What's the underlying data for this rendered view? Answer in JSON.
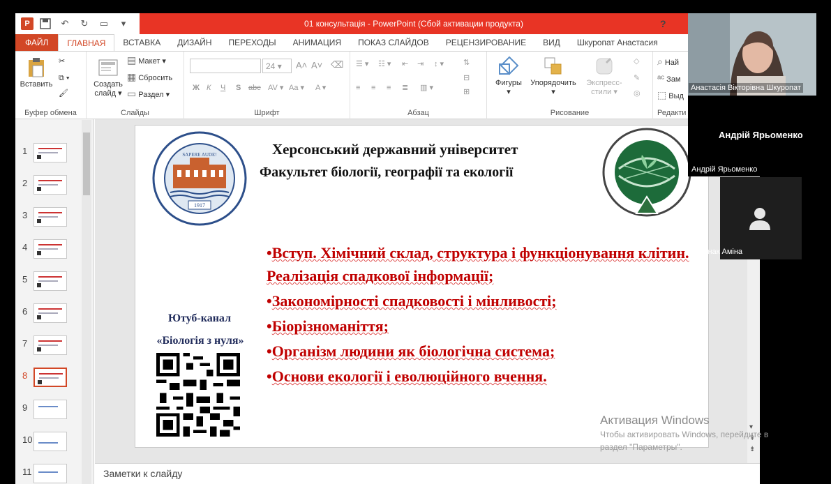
{
  "window": {
    "title": "01 консультація -  PowerPoint (Сбой активации продукта)",
    "help": "?"
  },
  "tabs": [
    {
      "label": "ФАЙЛ"
    },
    {
      "label": "ГЛАВНАЯ"
    },
    {
      "label": "ВСТАВКА"
    },
    {
      "label": "ДИЗАЙН"
    },
    {
      "label": "ПЕРЕХОДЫ"
    },
    {
      "label": "АНИМАЦИЯ"
    },
    {
      "label": "ПОКАЗ СЛАЙДОВ"
    },
    {
      "label": "РЕЦЕНЗИРОВАНИЕ"
    },
    {
      "label": "ВИД"
    },
    {
      "label": "Шкуропат Анастасия"
    }
  ],
  "ribbon": {
    "clipboard": {
      "label": "Буфер обмена",
      "paste": "Вставить"
    },
    "slides": {
      "label": "Слайды",
      "create": "Создать",
      "create2": "слайд",
      "layout": "Макет",
      "reset": "Сбросить",
      "section": "Раздел"
    },
    "font": {
      "label": "Шрифт",
      "size": "24",
      "bold": "Ж",
      "italic": "К",
      "underline": "Ч",
      "shadow": "S",
      "strike": "abc",
      "spacing": "AV",
      "case": "Aa",
      "color": "A"
    },
    "paragraph": {
      "label": "Абзац"
    },
    "drawing": {
      "label": "Рисование",
      "shapes": "Фигуры",
      "arrange": "Упорядочить",
      "styles": "Экспресс-",
      "styles2": "стили"
    },
    "editing": {
      "label": "Редакти",
      "find": "Най",
      "replace": "Зам",
      "select": "Выд"
    }
  },
  "thumbnails": [
    "1",
    "2",
    "3",
    "4",
    "5",
    "6",
    "7",
    "8",
    "9",
    "10",
    "11"
  ],
  "selected_slide": "8",
  "slide": {
    "heading1": "Херсонський державний університет",
    "heading2": "Факультет біології, географії та екології",
    "youtube1": "Ютуб-канал",
    "youtube2": "«Біологія з нуля»",
    "bullets": [
      {
        "dot": "•",
        "text": "Вступ. Хімічний склад, структура і функціонування клітин. Реалізація спадкової інформації;"
      },
      {
        "dot": "•",
        "text": "Закономірності спадковості і мінливості;"
      },
      {
        "dot": "•",
        "text": "Біорізноманіття;"
      },
      {
        "dot": "•",
        "text": "Організм людини як біологічна система;"
      },
      {
        "dot": "•",
        "text": "Основи екології і еволюційного вчення."
      }
    ],
    "logo_left_motto": "SAPERE AUDE!",
    "logo_left_year": "1917"
  },
  "notes": {
    "placeholder": "Заметки к слайду"
  },
  "activation": {
    "line1": "Активация Windows",
    "line2": "Чтобы активировать Windows, перейдите в",
    "line3": "раздел \"Параметры\"."
  },
  "call": {
    "speaker_name": "Анастасія Вікторівна Шкуропат",
    "participant2_center": "Андрій Ярьоменко",
    "participant2_name": "Андрій Ярьоменко",
    "participant3_name": "Гривнак Аміна"
  },
  "colors": {
    "accent": "#d24726",
    "title_red": "#e83425",
    "bullet_red": "#c00000"
  }
}
